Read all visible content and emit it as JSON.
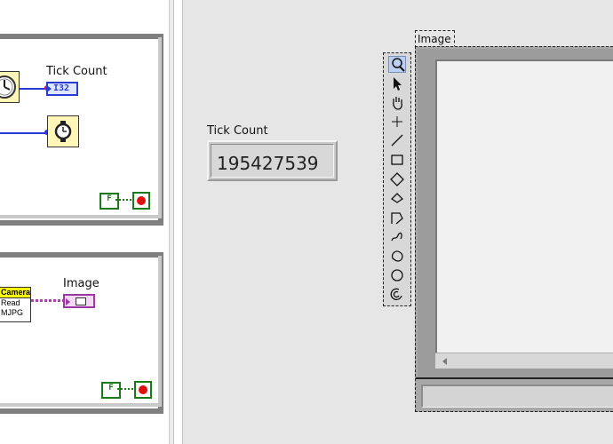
{
  "block_diagram": {
    "tick_count_label": "Tick Count",
    "tick_count_type": "I32",
    "image_label": "Image",
    "camera_header": "Camera",
    "camera_line1": "Read",
    "camera_line2": "MJPG",
    "false_constant": "F"
  },
  "front_panel": {
    "tick_count": {
      "label": "Tick Count",
      "value": "195427539"
    },
    "image": {
      "label": "Image"
    },
    "tools": [
      "zoom-icon",
      "pointer-icon",
      "pan-icon",
      "crosshair-icon",
      "line-icon",
      "rectangle-icon",
      "rotated-rectangle-icon",
      "polygon-icon",
      "broken-line-icon",
      "freehand-icon",
      "freehand-region-icon",
      "oval-icon",
      "annulus-icon"
    ]
  }
}
